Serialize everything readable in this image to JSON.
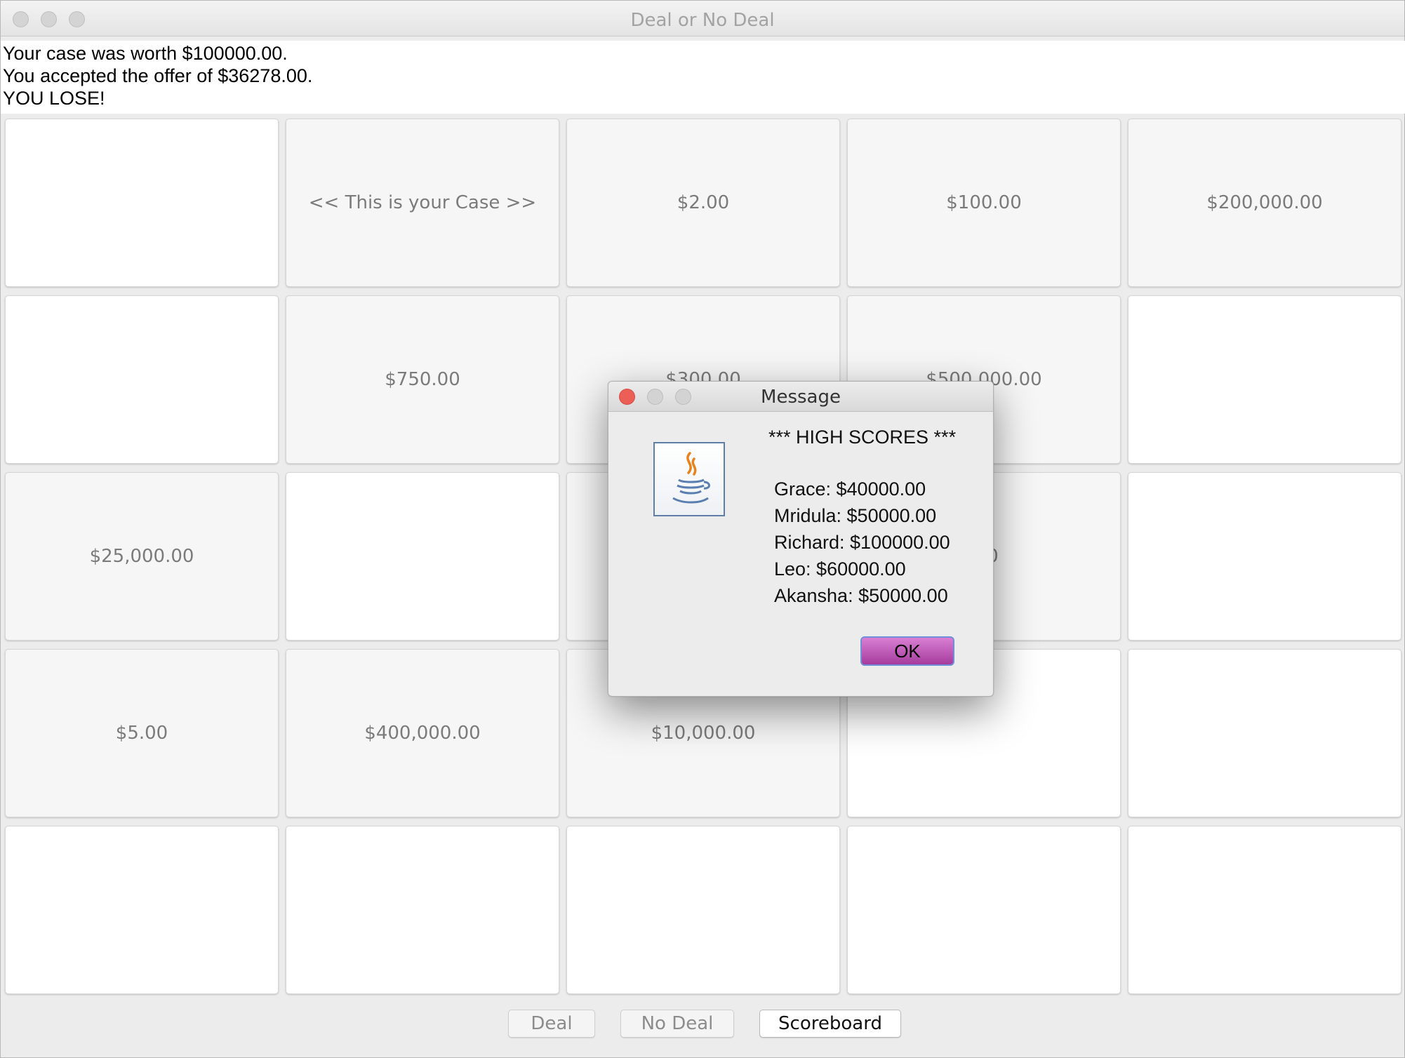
{
  "window": {
    "title": "Deal or No Deal"
  },
  "status": {
    "line1": "Your case was worth $100000.00.",
    "line2": "You accepted the offer of $36278.00.",
    "line3": "YOU LOSE!"
  },
  "cases": [
    {
      "label": "",
      "state": "blank"
    },
    {
      "label": "<< This is your Case >>",
      "state": "opened"
    },
    {
      "label": "$2.00",
      "state": "opened"
    },
    {
      "label": "$100.00",
      "state": "opened"
    },
    {
      "label": "$200,000.00",
      "state": "opened"
    },
    {
      "label": "",
      "state": "blank"
    },
    {
      "label": "$750.00",
      "state": "opened"
    },
    {
      "label": "$300.00",
      "state": "opened"
    },
    {
      "label": "$500,000.00",
      "state": "opened"
    },
    {
      "label": "",
      "state": "blank"
    },
    {
      "label": "$25,000.00",
      "state": "opened"
    },
    {
      "label": "",
      "state": "blank"
    },
    {
      "label": "",
      "state": "opened"
    },
    {
      "label": ".00",
      "state": "opened"
    },
    {
      "label": "",
      "state": "blank"
    },
    {
      "label": "$5.00",
      "state": "opened"
    },
    {
      "label": "$400,000.00",
      "state": "opened"
    },
    {
      "label": "$10,000.00",
      "state": "opened"
    },
    {
      "label": "",
      "state": "blank"
    },
    {
      "label": "",
      "state": "blank"
    },
    {
      "label": "",
      "state": "blank"
    },
    {
      "label": "",
      "state": "blank"
    },
    {
      "label": "",
      "state": "blank"
    },
    {
      "label": "",
      "state": "blank"
    },
    {
      "label": "",
      "state": "blank"
    }
  ],
  "buttons": {
    "deal": "Deal",
    "no_deal": "No Deal",
    "scoreboard": "Scoreboard"
  },
  "dialog": {
    "title": "Message",
    "icon": "java-coffee-icon",
    "header": "*** HIGH SCORES ***",
    "scores": [
      "Grace: $40000.00",
      "Mridula: $50000.00",
      "Richard: $100000.00",
      "Leo: $60000.00",
      "Akansha: $50000.00"
    ],
    "ok_label": "OK"
  },
  "colors": {
    "close_red": "#ec5f57",
    "ok_button": "#c25fb9"
  }
}
